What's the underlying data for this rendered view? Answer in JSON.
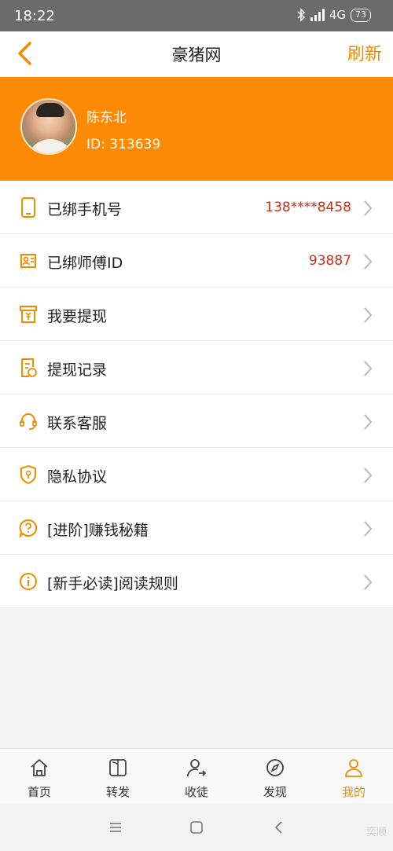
{
  "status_bar": {
    "time": "18:22",
    "network": "4G",
    "battery": "73"
  },
  "nav": {
    "title": "豪猪网",
    "refresh_label": "刷新"
  },
  "profile": {
    "name": "陈东北",
    "id_text": "ID: 313639"
  },
  "menu": {
    "items": [
      {
        "label": "已绑手机号",
        "value": "138****8458",
        "icon": "phone-icon"
      },
      {
        "label": "已绑师傅ID",
        "value": "93887",
        "icon": "id-card-icon"
      },
      {
        "label": "我要提现",
        "value": "",
        "icon": "withdraw-icon"
      },
      {
        "label": "提现记录",
        "value": "",
        "icon": "record-icon"
      },
      {
        "label": "联系客服",
        "value": "",
        "icon": "headset-icon"
      },
      {
        "label": "隐私协议",
        "value": "",
        "icon": "shield-icon"
      },
      {
        "label": "[进阶]赚钱秘籍",
        "value": "",
        "icon": "question-icon"
      },
      {
        "label": "[新手必读]阅读规则",
        "value": "",
        "icon": "info-icon"
      }
    ]
  },
  "tabs": [
    {
      "label": "首页",
      "icon": "home-icon"
    },
    {
      "label": "转发",
      "icon": "book-icon"
    },
    {
      "label": "收徒",
      "icon": "user-add-icon"
    },
    {
      "label": "发现",
      "icon": "compass-icon"
    },
    {
      "label": "我的",
      "icon": "user-icon",
      "active": true
    }
  ],
  "watermark": "奕顺",
  "colors": {
    "accent": "#fd8a05",
    "accent_text": "#f08c00",
    "value_red": "#cf2d16"
  }
}
